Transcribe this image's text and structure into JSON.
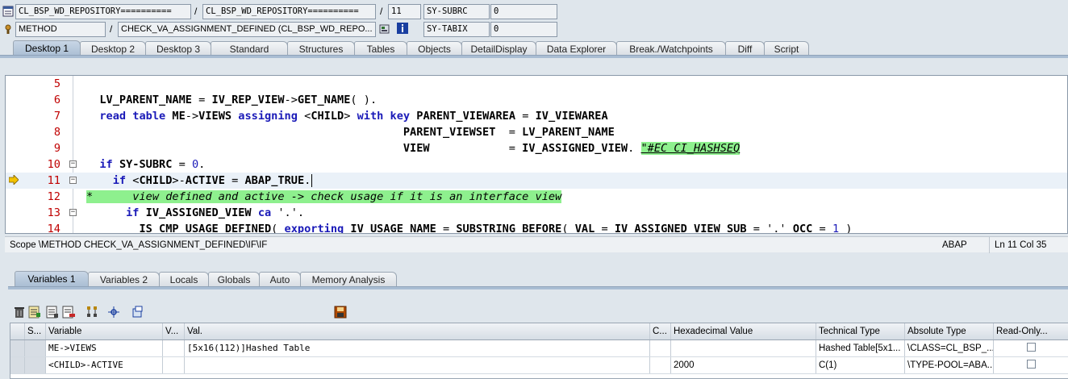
{
  "header": {
    "row1": {
      "program_left": "CL_BSP_WD_REPOSITORY==========",
      "sep1": "/",
      "program_right": "CL_BSP_WD_REPOSITORY==========",
      "sep2": "/",
      "line_no": "11",
      "sysvar_name": "SY-SUBRC",
      "sysvar_value": "0"
    },
    "row2": {
      "event_type": "METHOD",
      "sep": "/",
      "event_name": "CHECK_VA_ASSIGNMENT_DEFINED (CL_BSP_WD_REPO...",
      "sysvar_name": "SY-TABIX",
      "sysvar_value": "0"
    }
  },
  "desktop_tabs": [
    "Desktop 1",
    "Desktop 2",
    "Desktop 3",
    "Standard",
    "Structures",
    "Tables",
    "Objects",
    "DetailDisplay",
    "Data Explorer",
    "Break./Watchpoints",
    "Diff",
    "Script"
  ],
  "editor": {
    "lines": [
      {
        "num": "5",
        "text": ""
      },
      {
        "num": "6",
        "text": "LV_PARENT_NAME = IV_REP_VIEW->GET_NAME( )."
      },
      {
        "num": "7",
        "text": "read table ME->VIEWS assigning <CHILD> with key PARENT_VIEWAREA = IV_VIEWAREA"
      },
      {
        "num": "8",
        "text": "PARENT_VIEWSET  = LV_PARENT_NAME"
      },
      {
        "num": "9",
        "text": "VIEW            = IV_ASSIGNED_VIEW. \"#EC CI_HASHSEQ"
      },
      {
        "num": "10",
        "text": "if SY-SUBRC = 0."
      },
      {
        "num": "11",
        "text": "if <CHILD>-ACTIVE = ABAP_TRUE."
      },
      {
        "num": "12",
        "text": "*      view defined and active -> check usage if it is an interface view"
      },
      {
        "num": "13",
        "text": "if IV_ASSIGNED_VIEW ca '.'."
      },
      {
        "num": "14",
        "text": "IS_CMP_USAGE_DEFINED( exporting IV_USAGE_NAME = SUBSTRING_BEFORE( VAL = IV_ASSIGNED_VIEW_SUB = '.' OCC = 1 )"
      }
    ]
  },
  "status": {
    "scope": "Scope \\METHOD CHECK_VA_ASSIGNMENT_DEFINED\\IF\\IF",
    "lang": "ABAP",
    "pos": "Ln   11 Col   35"
  },
  "variable_tabs": [
    "Variables 1",
    "Variables 2",
    "Locals",
    "Globals",
    "Auto",
    "Memory Analysis"
  ],
  "table": {
    "headers": [
      "S...",
      "Variable",
      "V...",
      "Val.",
      "C...",
      "Hexadecimal Value",
      "Technical Type",
      "Absolute Type",
      "Read-Only..."
    ],
    "rows": [
      [
        "",
        "ME->VIEWS",
        "",
        "[5x16(112)]Hashed Table",
        "",
        "",
        "Hashed Table[5x1...",
        "\\CLASS=CL_BSP_...",
        ""
      ],
      [
        "",
        "<CHILD>-ACTIVE",
        "",
        "",
        "",
        "2000",
        "C(1)",
        "\\TYPE-POOL=ABA...",
        ""
      ]
    ]
  },
  "icons": {
    "row1_prefix": "program-icon",
    "row2_prefix": "method-icon",
    "toolbar": [
      "delete-icon",
      "variables-icon",
      "list-icon",
      "remove-icon",
      "tree-icon",
      "navigate-icon",
      "object-icon",
      "save-icon"
    ]
  },
  "colors": {
    "accent_tab": "#a9bdd3",
    "keyword": "#1a1ab8",
    "comment_bg": "#8ef08e",
    "line_number": "#c00000"
  }
}
